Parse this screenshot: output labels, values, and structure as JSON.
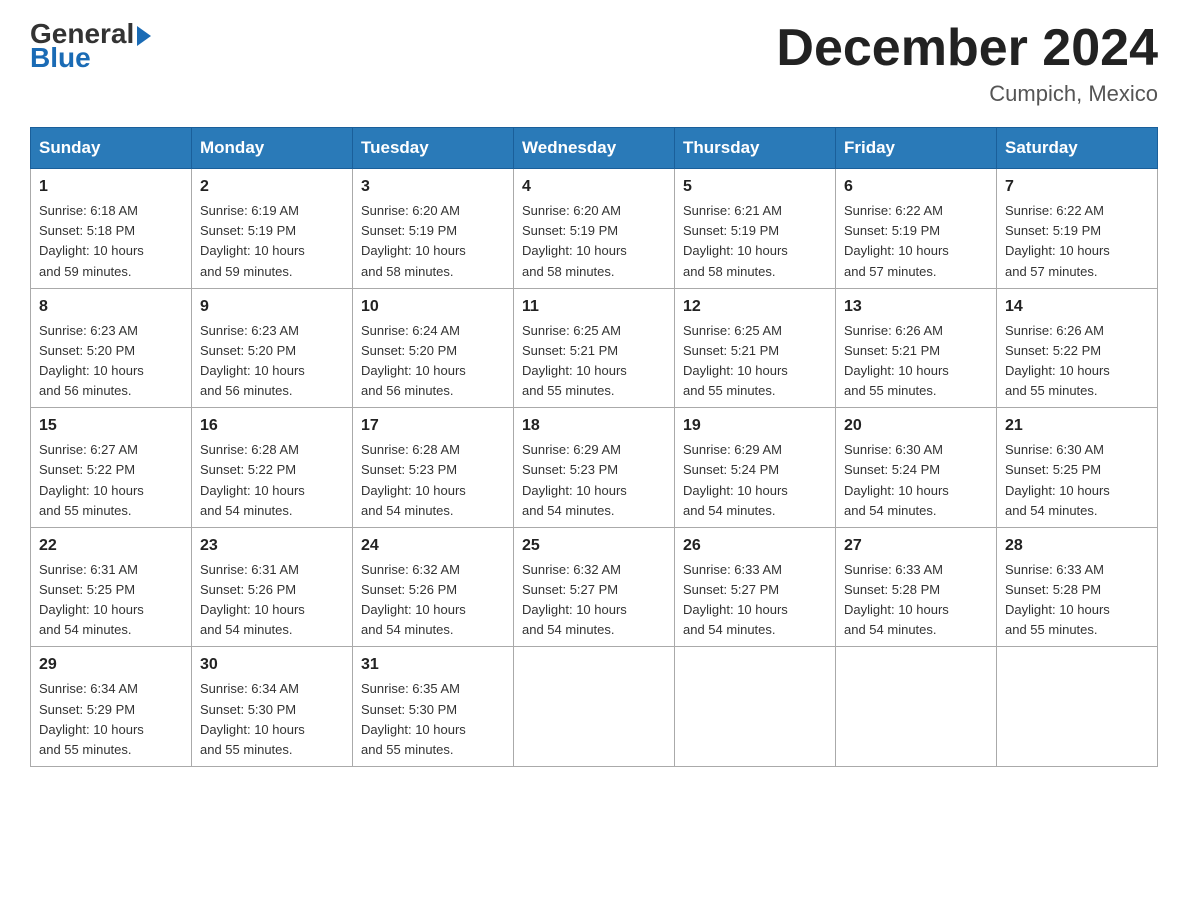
{
  "logo": {
    "general": "General",
    "blue": "Blue"
  },
  "title": {
    "month_year": "December 2024",
    "location": "Cumpich, Mexico"
  },
  "days_of_week": [
    "Sunday",
    "Monday",
    "Tuesday",
    "Wednesday",
    "Thursday",
    "Friday",
    "Saturday"
  ],
  "weeks": [
    [
      {
        "day": "1",
        "sunrise": "6:18 AM",
        "sunset": "5:18 PM",
        "daylight": "10 hours and 59 minutes."
      },
      {
        "day": "2",
        "sunrise": "6:19 AM",
        "sunset": "5:19 PM",
        "daylight": "10 hours and 59 minutes."
      },
      {
        "day": "3",
        "sunrise": "6:20 AM",
        "sunset": "5:19 PM",
        "daylight": "10 hours and 58 minutes."
      },
      {
        "day": "4",
        "sunrise": "6:20 AM",
        "sunset": "5:19 PM",
        "daylight": "10 hours and 58 minutes."
      },
      {
        "day": "5",
        "sunrise": "6:21 AM",
        "sunset": "5:19 PM",
        "daylight": "10 hours and 58 minutes."
      },
      {
        "day": "6",
        "sunrise": "6:22 AM",
        "sunset": "5:19 PM",
        "daylight": "10 hours and 57 minutes."
      },
      {
        "day": "7",
        "sunrise": "6:22 AM",
        "sunset": "5:19 PM",
        "daylight": "10 hours and 57 minutes."
      }
    ],
    [
      {
        "day": "8",
        "sunrise": "6:23 AM",
        "sunset": "5:20 PM",
        "daylight": "10 hours and 56 minutes."
      },
      {
        "day": "9",
        "sunrise": "6:23 AM",
        "sunset": "5:20 PM",
        "daylight": "10 hours and 56 minutes."
      },
      {
        "day": "10",
        "sunrise": "6:24 AM",
        "sunset": "5:20 PM",
        "daylight": "10 hours and 56 minutes."
      },
      {
        "day": "11",
        "sunrise": "6:25 AM",
        "sunset": "5:21 PM",
        "daylight": "10 hours and 55 minutes."
      },
      {
        "day": "12",
        "sunrise": "6:25 AM",
        "sunset": "5:21 PM",
        "daylight": "10 hours and 55 minutes."
      },
      {
        "day": "13",
        "sunrise": "6:26 AM",
        "sunset": "5:21 PM",
        "daylight": "10 hours and 55 minutes."
      },
      {
        "day": "14",
        "sunrise": "6:26 AM",
        "sunset": "5:22 PM",
        "daylight": "10 hours and 55 minutes."
      }
    ],
    [
      {
        "day": "15",
        "sunrise": "6:27 AM",
        "sunset": "5:22 PM",
        "daylight": "10 hours and 55 minutes."
      },
      {
        "day": "16",
        "sunrise": "6:28 AM",
        "sunset": "5:22 PM",
        "daylight": "10 hours and 54 minutes."
      },
      {
        "day": "17",
        "sunrise": "6:28 AM",
        "sunset": "5:23 PM",
        "daylight": "10 hours and 54 minutes."
      },
      {
        "day": "18",
        "sunrise": "6:29 AM",
        "sunset": "5:23 PM",
        "daylight": "10 hours and 54 minutes."
      },
      {
        "day": "19",
        "sunrise": "6:29 AM",
        "sunset": "5:24 PM",
        "daylight": "10 hours and 54 minutes."
      },
      {
        "day": "20",
        "sunrise": "6:30 AM",
        "sunset": "5:24 PM",
        "daylight": "10 hours and 54 minutes."
      },
      {
        "day": "21",
        "sunrise": "6:30 AM",
        "sunset": "5:25 PM",
        "daylight": "10 hours and 54 minutes."
      }
    ],
    [
      {
        "day": "22",
        "sunrise": "6:31 AM",
        "sunset": "5:25 PM",
        "daylight": "10 hours and 54 minutes."
      },
      {
        "day": "23",
        "sunrise": "6:31 AM",
        "sunset": "5:26 PM",
        "daylight": "10 hours and 54 minutes."
      },
      {
        "day": "24",
        "sunrise": "6:32 AM",
        "sunset": "5:26 PM",
        "daylight": "10 hours and 54 minutes."
      },
      {
        "day": "25",
        "sunrise": "6:32 AM",
        "sunset": "5:27 PM",
        "daylight": "10 hours and 54 minutes."
      },
      {
        "day": "26",
        "sunrise": "6:33 AM",
        "sunset": "5:27 PM",
        "daylight": "10 hours and 54 minutes."
      },
      {
        "day": "27",
        "sunrise": "6:33 AM",
        "sunset": "5:28 PM",
        "daylight": "10 hours and 54 minutes."
      },
      {
        "day": "28",
        "sunrise": "6:33 AM",
        "sunset": "5:28 PM",
        "daylight": "10 hours and 55 minutes."
      }
    ],
    [
      {
        "day": "29",
        "sunrise": "6:34 AM",
        "sunset": "5:29 PM",
        "daylight": "10 hours and 55 minutes."
      },
      {
        "day": "30",
        "sunrise": "6:34 AM",
        "sunset": "5:30 PM",
        "daylight": "10 hours and 55 minutes."
      },
      {
        "day": "31",
        "sunrise": "6:35 AM",
        "sunset": "5:30 PM",
        "daylight": "10 hours and 55 minutes."
      },
      null,
      null,
      null,
      null
    ]
  ],
  "labels": {
    "sunrise": "Sunrise:",
    "sunset": "Sunset:",
    "daylight": "Daylight:"
  }
}
